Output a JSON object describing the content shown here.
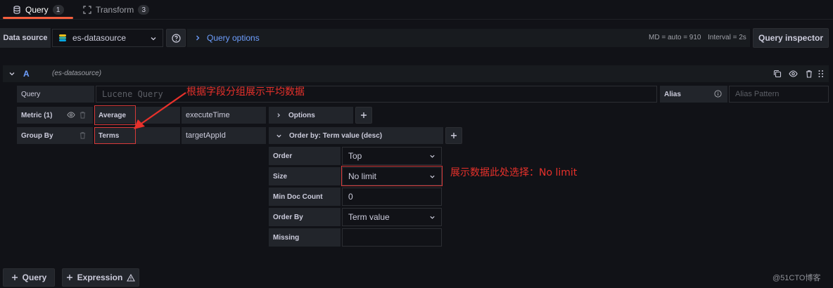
{
  "tabs": [
    {
      "label": "Query",
      "count": "1"
    },
    {
      "label": "Transform",
      "count": "3"
    }
  ],
  "toolbar": {
    "datasource_label": "Data source",
    "datasource_value": "es-datasource",
    "query_options": "Query options",
    "md_text": "MD = auto = 910",
    "interval_text": "Interval = 2s",
    "inspector_label": "Query inspector"
  },
  "query_row": {
    "letter": "A",
    "datasource": "(es-datasource)"
  },
  "query_field": {
    "label": "Query",
    "placeholder": "Lucene Query",
    "alias_label": "Alias",
    "alias_placeholder": "Alias Pattern"
  },
  "metric": {
    "label": "Metric (1)",
    "type": "Average",
    "field": "executeTime",
    "options": "Options"
  },
  "group_by": {
    "label": "Group By",
    "type": "Terms",
    "field": "targetAppId",
    "order_by_header": "Order by: Term value (desc)"
  },
  "settings": {
    "order_label": "Order",
    "order_value": "Top",
    "size_label": "Size",
    "size_value": "No limit",
    "min_doc_label": "Min Doc Count",
    "min_doc_value": "0",
    "order_by_label": "Order By",
    "order_by_value": "Term value",
    "missing_label": "Missing",
    "missing_value": ""
  },
  "annotations": {
    "top": "根据字段分组展示平均数据",
    "size": "展示数据此处选择：No limit"
  },
  "footer": {
    "add_query": "Query",
    "add_expression": "Expression",
    "watermark": "@51CTO博客"
  },
  "colors": {
    "accent": "#f55f3e",
    "link": "#6e9fff",
    "annotation": "#e8312b"
  }
}
